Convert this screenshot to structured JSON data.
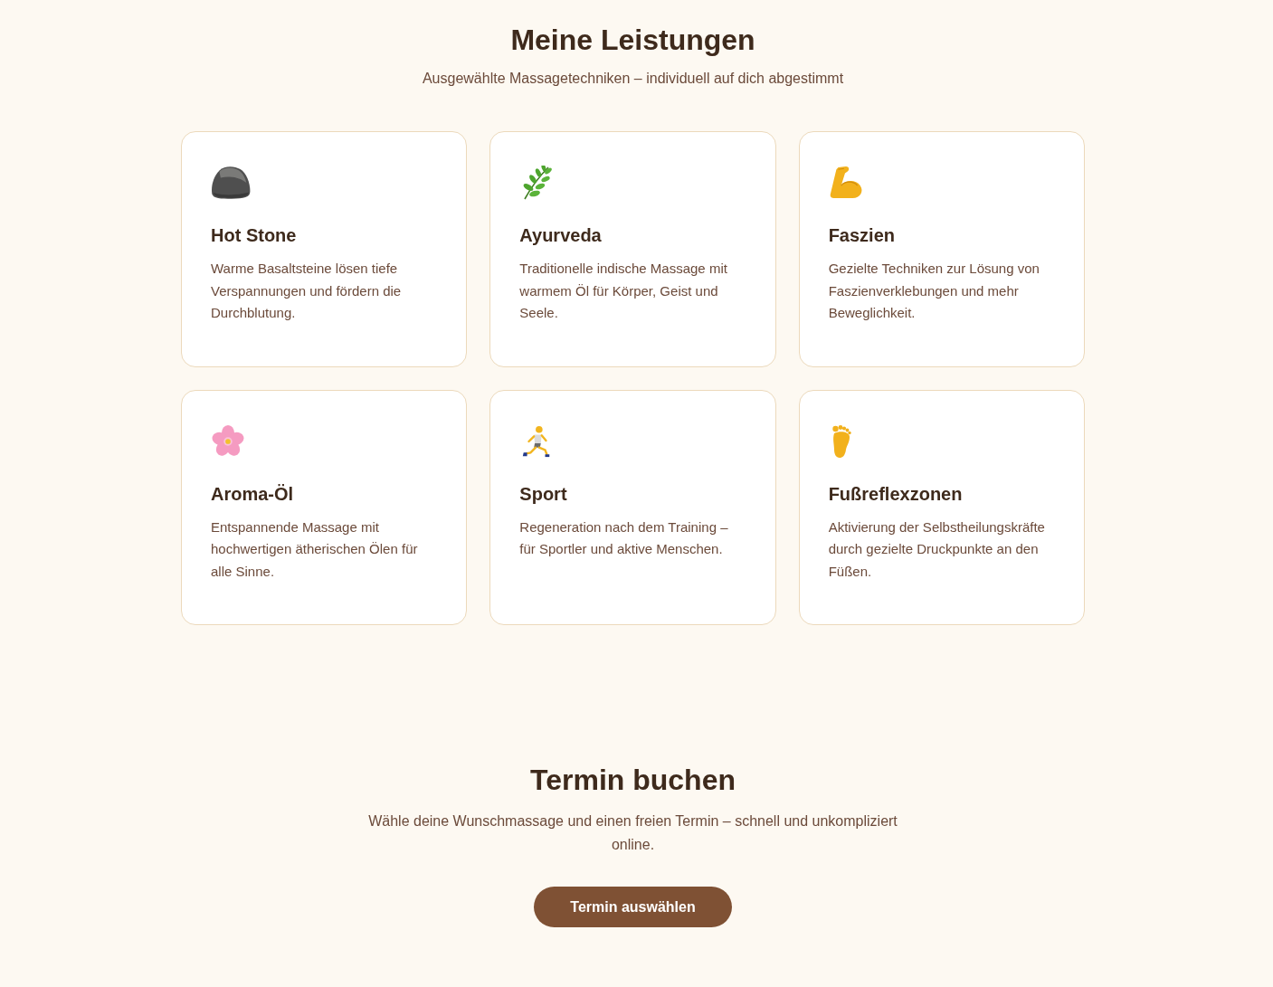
{
  "services": {
    "title": "Meine Leistungen",
    "subtitle": "Ausgewählte Massagetechniken – individuell auf dich abgestimmt",
    "cards": [
      {
        "kind": "stone",
        "title": "Hot Stone",
        "text": "Warme Basaltsteine lösen tiefe Verspannungen und fördern die Durchblutung."
      },
      {
        "kind": "leaf",
        "title": "Ayurveda",
        "text": "Traditionelle indische Massage mit warmem Öl für Körper, Geist und Seele."
      },
      {
        "kind": "muscle",
        "title": "Faszien",
        "text": "Gezielte Techniken zur Lösung von Faszienverklebungen und mehr Beweglichkeit."
      },
      {
        "kind": "flower",
        "title": "Aroma-Öl",
        "text": "Entspannende Massage mit hochwertigen ätherischen Ölen für alle Sinne."
      },
      {
        "kind": "runner",
        "title": "Sport",
        "text": "Regeneration nach dem Training – für Sportler und aktive Menschen."
      },
      {
        "kind": "foot",
        "title": "Fußreflexzonen",
        "text": "Aktivierung der Selbstheilungskräfte durch gezielte Druckpunkte an den Füßen."
      }
    ]
  },
  "booking": {
    "title": "Termin buchen",
    "text": "Wähle deine Wunschmassage und einen freien Termin – schnell und unkompliziert online.",
    "button": "Termin auswählen"
  }
}
